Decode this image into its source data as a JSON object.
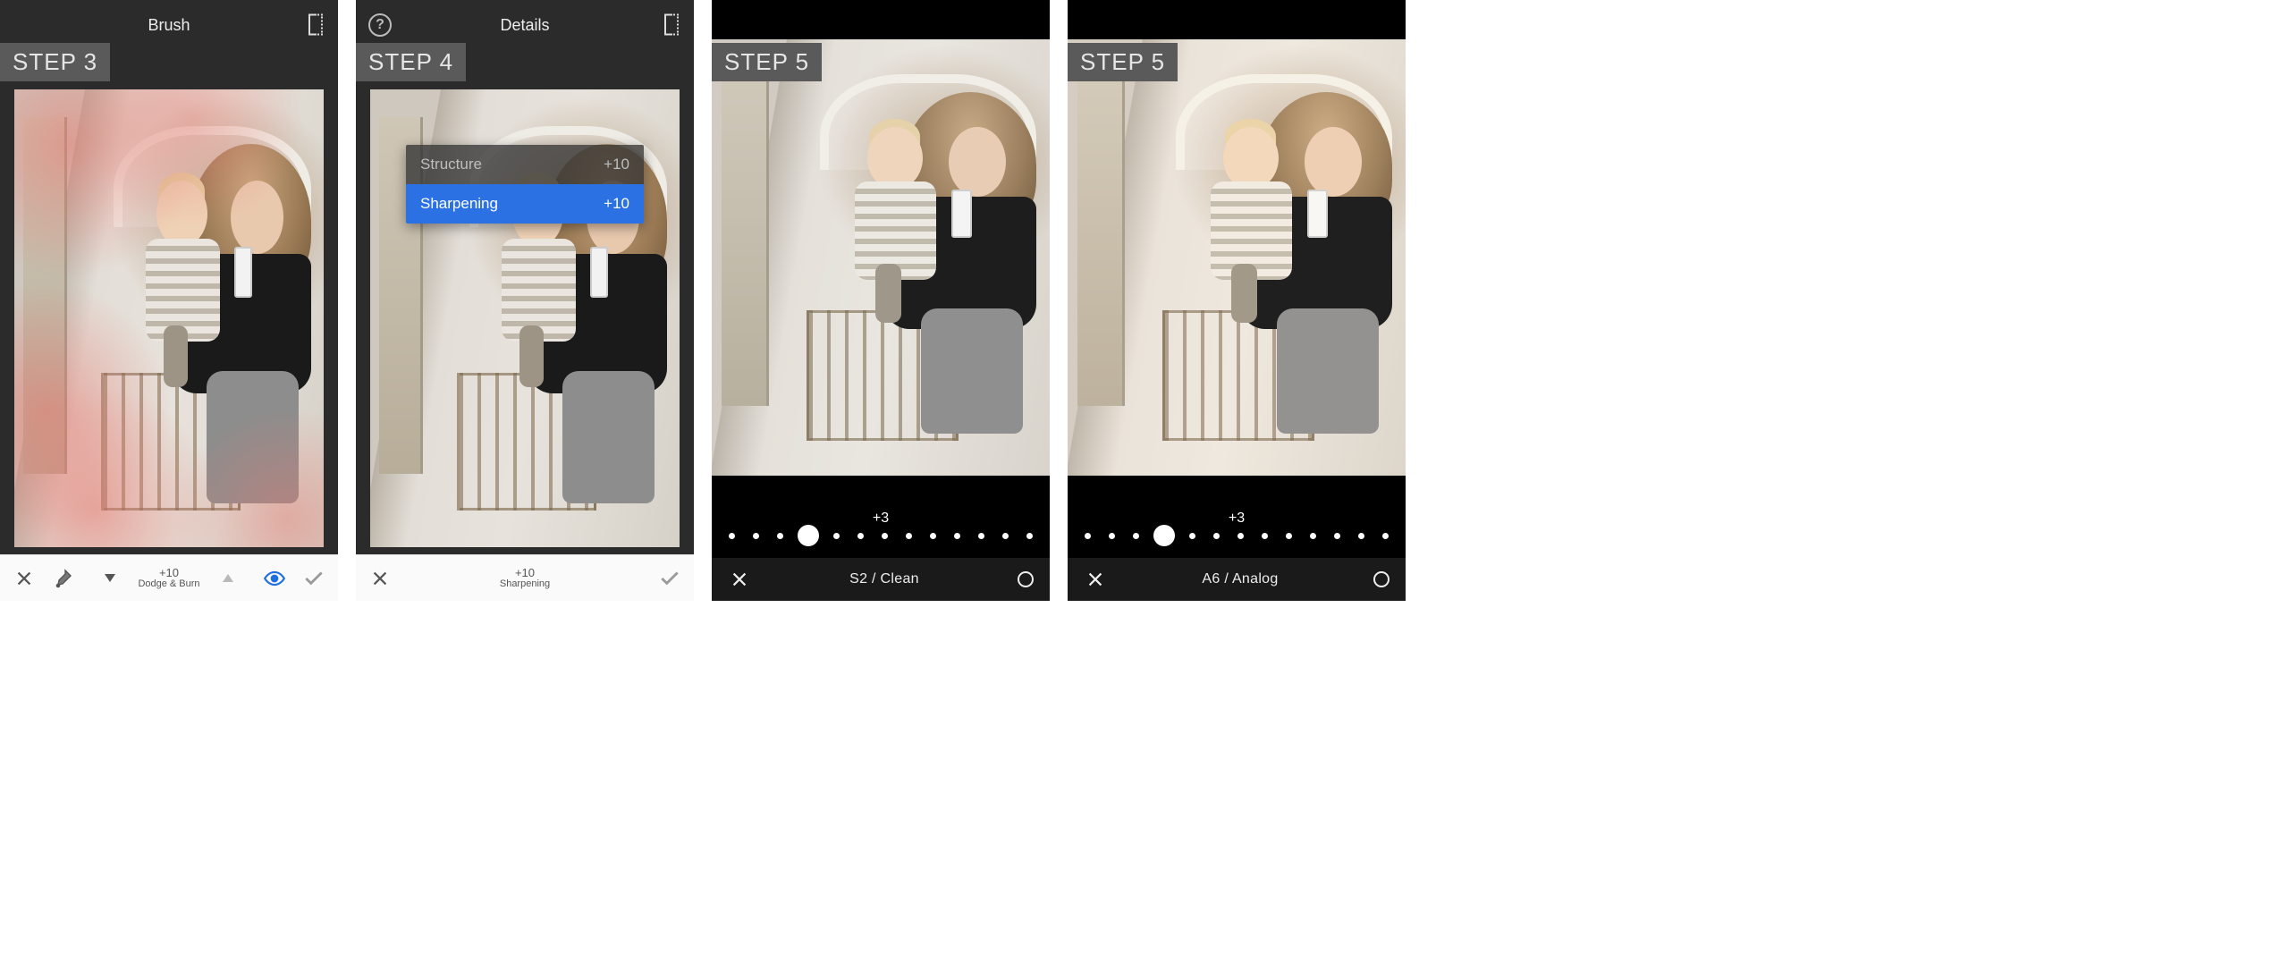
{
  "panels": [
    {
      "app": "snapseed",
      "header_title": "Brush",
      "step_label": "STEP 3",
      "toolbar": {
        "value": "+10",
        "mode": "Dodge & Burn"
      }
    },
    {
      "app": "snapseed",
      "header_title": "Details",
      "step_label": "STEP 4",
      "menu": {
        "structure_label": "Structure",
        "structure_value": "+10",
        "sharpening_label": "Sharpening",
        "sharpening_value": "+10"
      },
      "toolbar": {
        "value": "+10",
        "mode": "Sharpening"
      }
    },
    {
      "app": "vsco",
      "step_label": "STEP 5",
      "slider_value": "+3",
      "preset_label": "S2 / Clean"
    },
    {
      "app": "vsco",
      "step_label": "STEP 5",
      "slider_value": "+3",
      "preset_label": "A6 / Analog"
    }
  ]
}
